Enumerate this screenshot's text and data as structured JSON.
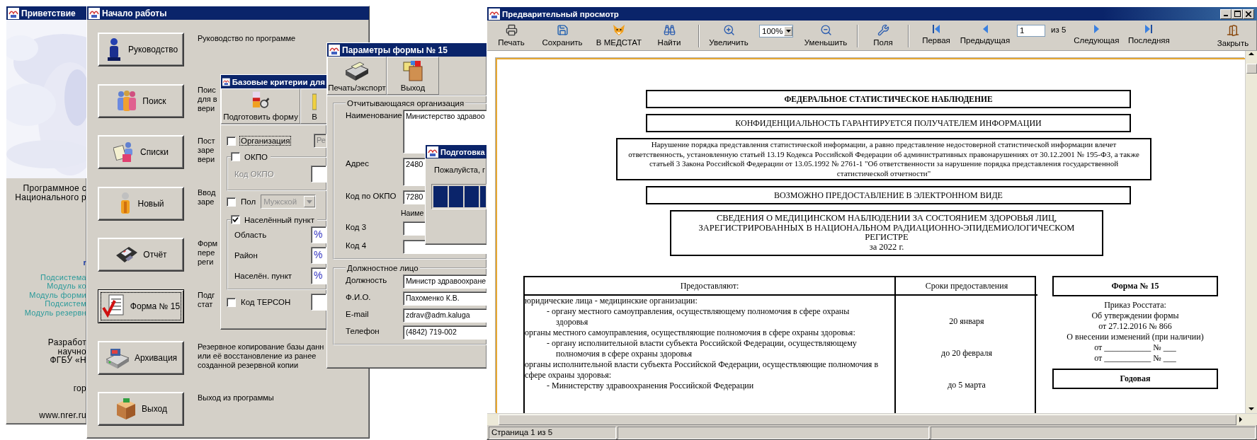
{
  "welcome": {
    "title": "Приветствие",
    "blocks": [
      {
        "kind": "plain",
        "lines": [
          "Программное с",
          "Национального р"
        ]
      },
      {
        "kind": "link",
        "lines": [
          "r"
        ]
      },
      {
        "kind": "module",
        "lines": [
          "Подсистема",
          "Модуль ко",
          "Модуль форми",
          "Подсистем",
          "Модуль резервн"
        ]
      },
      {
        "kind": "plain",
        "lines": [
          "Разработ",
          "научно",
          "ФГБУ «Н"
        ]
      },
      {
        "kind": "plain",
        "lines": [
          "гор"
        ]
      },
      {
        "kind": "plain",
        "lines": [
          "www.nrer.ru"
        ]
      }
    ]
  },
  "start": {
    "title": "Начало работы",
    "items": [
      {
        "label": "Руководство",
        "focused": false,
        "description": [
          "Руководство по программе"
        ]
      },
      {
        "label": "Поиск",
        "focused": false,
        "description": [
          "Поис",
          "для в",
          "вери"
        ]
      },
      {
        "label": "Списки",
        "focused": false,
        "description": [
          "Пост",
          "заре",
          "вери"
        ]
      },
      {
        "label": "Новый",
        "focused": false,
        "description": [
          "Ввод",
          "заре"
        ]
      },
      {
        "label": "Отчёт",
        "focused": false,
        "description": [
          "Форм",
          "пере",
          "реги"
        ]
      },
      {
        "label": "Форма № 15",
        "focused": true,
        "description": [
          "Подг",
          "стат"
        ]
      },
      {
        "label": "Архивация",
        "focused": false,
        "description": [
          "Резервное копирование базы данн",
          "или её восстановление из ранее",
          "созданной резервной копии"
        ]
      },
      {
        "label": "Выход",
        "focused": false,
        "description": [
          "Выход из программы"
        ]
      }
    ]
  },
  "criteria": {
    "title": "Базовые критерии для",
    "tools": [
      {
        "label": "Подготовить форму"
      },
      {
        "label": "В"
      }
    ],
    "organization": {
      "label": "Организация",
      "checked": false,
      "focused": true,
      "value": "Ре"
    },
    "okpo": {
      "label": "ОКПО",
      "checked": false,
      "field_label": "Код ОКПО"
    },
    "sex": {
      "label": "Пол",
      "checked": false,
      "value": "Мужской"
    },
    "locality": {
      "label": "Населённый пункт",
      "checked": true,
      "fields": [
        {
          "label": "Область",
          "value": "%"
        },
        {
          "label": "Район",
          "value": "%"
        },
        {
          "label": "Населён. пункт",
          "value": "%"
        }
      ]
    },
    "terson": {
      "label": "Код ТЕРСОН",
      "checked": false
    }
  },
  "params": {
    "title": "Параметры формы № 15",
    "tools": [
      {
        "label": "Печать/экспорт"
      },
      {
        "label": "Выход"
      }
    ],
    "org_group": {
      "title": "Отчитывающаяся организация",
      "fields": [
        {
          "kind": "multiline",
          "label": "Наименование",
          "value": "Министерство здравоо"
        },
        {
          "kind": "address",
          "label": "Адрес",
          "value": "2480"
        },
        {
          "kind": "short",
          "label": "Код по ОКПО",
          "value": "7280"
        },
        {
          "kind": "caption",
          "label": "Наиме"
        },
        {
          "kind": "short",
          "label": "Код 3"
        },
        {
          "kind": "line",
          "label": "Код 4"
        }
      ]
    },
    "person_group": {
      "title": "Должностное лицо",
      "fields": [
        {
          "label": "Должность",
          "value": "Министр здравоохране"
        },
        {
          "label": "Ф.И.О.",
          "value": "Пахоменко К.В."
        },
        {
          "label": "E-mail",
          "value": "zdrav@adm.kaluga"
        },
        {
          "label": "Телефон",
          "value": "(4842) 719-002"
        }
      ]
    }
  },
  "progress": {
    "title": "Подготовка",
    "message": "Пожалуйста, г",
    "level": 1
  },
  "preview": {
    "title": "Предварительный просмотр",
    "toolbar": [
      [
        {
          "kind": "button",
          "label": "Печать"
        },
        {
          "kind": "button",
          "label": "Сохранить"
        },
        {
          "kind": "button",
          "label": "В МЕДСТАТ"
        },
        {
          "kind": "button",
          "label": "Найти"
        }
      ],
      [
        {
          "kind": "button",
          "label": "Увеличить"
        },
        {
          "kind": "select",
          "value": "100%"
        },
        {
          "kind": "button",
          "label": "Уменьшить"
        }
      ],
      [
        {
          "kind": "button",
          "label": "Поля"
        }
      ],
      [
        {
          "kind": "button",
          "label": "Первая"
        },
        {
          "kind": "button",
          "label": "Предыдущая"
        },
        {
          "kind": "page",
          "value": "1",
          "total": "из 5"
        },
        {
          "kind": "button",
          "label": "Следующая"
        },
        {
          "kind": "button",
          "label": "Последняя"
        }
      ]
    ],
    "close": {
      "label": "Закрыть"
    },
    "document": {
      "header_boxes": [
        {
          "kind": "bold",
          "text": "ФЕДЕРАЛЬНОЕ СТАТИСТИЧЕСКОЕ НАБЛЮДЕНИЕ"
        },
        {
          "kind": "plain",
          "text": "КОНФИДЕНЦИАЛЬНОСТЬ ГАРАНТИРУЕТСЯ ПОЛУЧАТЕЛЕМ ИНФОРМАЦИИ"
        },
        {
          "kind": "notice",
          "text": "Нарушение порядка представления статистической информации, а равно представление недостоверной статистической информации влечет ответственность, установленную статьей 13.19 Кодекса Российской Федерации об административных правонарушениях от 30.12.2001 № 195-ФЗ, а также статьей 3 Закона Российской Федерации от 13.05.1992 № 2761-1 \"Об ответственности за нарушение порядка представления государственной статистической отчетности\""
        },
        {
          "kind": "plain",
          "text": "ВОЗМОЖНО ПРЕДОСТАВЛЕНИЕ В ЭЛЕКТРОННОМ ВИДЕ"
        }
      ],
      "report_title": [
        "СВЕДЕНИЯ О МЕДИЦИНСКОМ НАБЛЮДЕНИИ ЗА СОСТОЯНИЕМ ЗДОРОВЬЯ ЛИЦ,",
        "ЗАРЕГИСТРИРОВАННЫХ В НАЦИОНАЛЬНОМ РАДИАЦИОННО-ЭПИДЕМИОЛОГИЧЕСКОМ",
        "РЕГИСТРЕ",
        "за 2022 г."
      ],
      "table": {
        "columns": [
          "Предоставляют:",
          "Сроки предоставления"
        ],
        "rows": [
          {
            "heading": "юридические лица - медицинские организации:",
            "item": "- органу местного самоуправления, осуществляющему полномочия в сфере охраны здоровья",
            "deadline": "20 января"
          },
          {
            "heading": "органы местного самоуправления, осуществляющие полномочия в сфере охраны здоровья:",
            "item": "- органу исполнительной власти субъекта Российской Федерации, осуществляющему полномочия в сфере охраны здоровья",
            "deadline": "до 20 февраля"
          },
          {
            "heading": "органы исполнительной власти субъекта Российской Федерации, осуществляющие полномочия в сфере охраны здоровья:",
            "item": "- Министерству здравоохранения Российской Федерации",
            "deadline": "до 5 марта"
          }
        ]
      },
      "form_box": "Форма № 15",
      "order_lines": [
        "Приказ Росстата:",
        "Об утверждении формы",
        "от 27.12.2016 № 866",
        "О внесении изменений (при наличии)",
        "от ___________ № ___",
        "от ___________ № ___"
      ],
      "period_box": "Годовая"
    },
    "status_bar": [
      "Страница 1 из 5"
    ]
  }
}
